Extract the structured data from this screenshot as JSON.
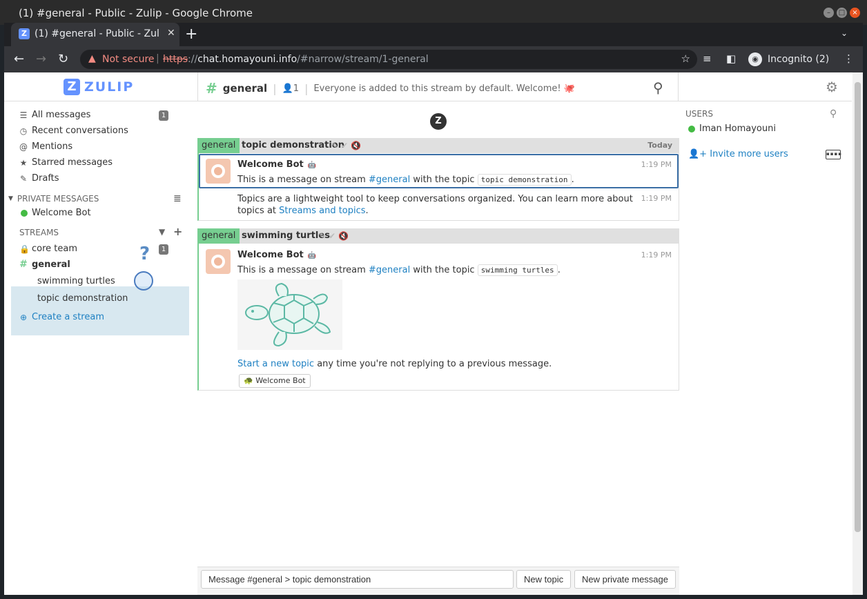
{
  "window": {
    "title": "(1) #general - Public - Zulip - Google Chrome"
  },
  "browser": {
    "tab_title": "(1) #general - Public - Zulip",
    "not_secure": "Not secure",
    "url_proto": "https",
    "url_sep": "://",
    "url_host": "chat.homayouni.info",
    "url_path": "/#narrow/stream/1-general",
    "incognito_label": "Incognito (2)"
  },
  "app": {
    "logo_text": "ZULIP",
    "narrow": {
      "stream_name": "general",
      "subscriber_count": "1",
      "description": "Everyone is added to this stream by default. Welcome! 🐙"
    }
  },
  "left_sidebar": {
    "all_messages": "All messages",
    "all_messages_count": "1",
    "recent": "Recent conversations",
    "mentions": "Mentions",
    "starred": "Starred messages",
    "drafts": "Drafts",
    "private_header": "PRIVATE MESSAGES",
    "pm_user": "Welcome Bot",
    "streams_header": "STREAMS",
    "streams": [
      {
        "name": "core team",
        "count": "1"
      },
      {
        "name": "general"
      }
    ],
    "topics": [
      "swimming turtles",
      "topic demonstration"
    ],
    "create_stream": "Create a stream"
  },
  "messages": {
    "groups": [
      {
        "stream": "general",
        "topic": "topic demonstration",
        "date": "Today",
        "sender": "Welcome Bot",
        "time1": "1:19 PM",
        "msg1_pre": "This is a message on stream ",
        "msg1_link": "#general",
        "msg1_mid": " with the topic ",
        "msg1_code": "topic demonstration",
        "msg1_end": ".",
        "time2": "1:19 PM",
        "msg2_line1": "Topics are a lightweight tool to keep conversations organized. You can learn more about",
        "msg2_line2_pre": "topics at ",
        "msg2_link": "Streams and topics",
        "msg2_end": "."
      },
      {
        "stream": "general",
        "topic": "swimming turtles",
        "sender": "Welcome Bot",
        "time1": "1:19 PM",
        "msg1_pre": "This is a message on stream ",
        "msg1_link": "#general",
        "msg1_mid": " with the topic ",
        "msg1_code": "swimming turtles",
        "msg1_end": ".",
        "msg2_link": "Start a new topic",
        "msg2_rest": " any time you're not replying to a previous message.",
        "reaction": "Welcome Bot"
      }
    ]
  },
  "right_sidebar": {
    "users_header": "USERS",
    "user": "Iman Homayouni",
    "invite": "Invite more users"
  },
  "compose": {
    "placeholder": "Message #general > topic demonstration",
    "new_topic": "New topic",
    "new_pm": "New private message"
  },
  "colors": {
    "stream_general": "#76ce90",
    "link": "#1e80c2",
    "zulip_blue": "#6492fe"
  }
}
